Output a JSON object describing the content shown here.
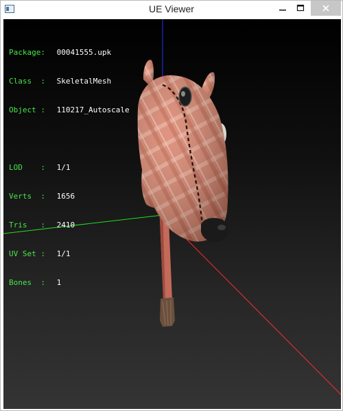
{
  "window": {
    "title": "UE Viewer"
  },
  "controls": {
    "minimize_icon": "minimize-icon",
    "maximize_icon": "maximize-icon",
    "close_icon": "close-icon"
  },
  "info": {
    "package": {
      "label": "Package:",
      "value": "00041555.upk"
    },
    "class": {
      "label": "Class  :",
      "value": "SkeletalMesh"
    },
    "object": {
      "label": "Object :",
      "value": "110217_Autoscale"
    },
    "lod": {
      "label": "LOD    :",
      "value": "1/1"
    },
    "verts": {
      "label": "Verts  :",
      "value": "1656"
    },
    "tris": {
      "label": "Tris   :",
      "value": "2410"
    },
    "uvset": {
      "label": "UV Set :",
      "value": "1/1"
    },
    "bones": {
      "label": "Bones  :",
      "value": "1"
    }
  },
  "colors": {
    "label": "#49e649",
    "value": "#ffffff",
    "axis_x": "#ff2a2a",
    "axis_y": "#22dd22",
    "axis_z": "#2233ff"
  }
}
